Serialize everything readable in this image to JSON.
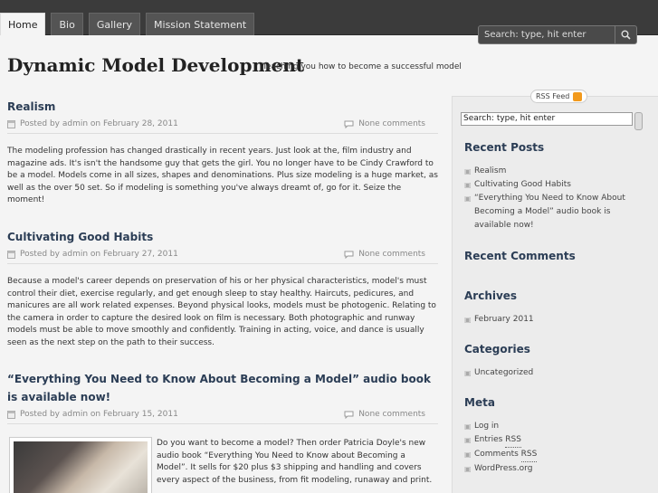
{
  "nav": {
    "tabs": [
      "Home",
      "Bio",
      "Gallery",
      "Mission Statement"
    ],
    "active": 0
  },
  "top_search": {
    "placeholder": "Search: type, hit enter"
  },
  "header": {
    "title": "Dynamic Model Development",
    "tagline": "Teaching you how to become a successful model"
  },
  "posts": [
    {
      "title": "Realism",
      "meta": "Posted by admin on February 28, 2011",
      "comments": "None comments",
      "body": "The modeling  profession has changed drastically in recent years.  Just look at the, film industry and magazine ads.  It's isn't  the handsome guy that gets the girl.  You no longer have to be Cindy Crawford to be a model.  Models come in all sizes, shapes and denominations.  Plus size modeling is a huge market, as well as the over 50 set.  So if modeling is something you've always dreamt of,  go for it.   Seize the moment!"
    },
    {
      "title": "Cultivating Good Habits",
      "meta": "Posted by admin on February 27, 2011",
      "comments": "None comments",
      "body": "Because a model's career depends on preservation of his or her physical characteristics, model's must control their diet, exercise regularly, and get enough sleep to stay healthy.  Haircuts, pedicures, and manicures are all work related expenses.  Beyond physical looks, models must be photogenic.  Relating to the camera in order to capture the desired look on film is necessary.   Both photographic and runway models must be able to move smoothly and confidently.  Training in acting, voice, and dance is usually seen as the next step on the path to their success."
    },
    {
      "title": "“Everything You Need to Know About Becoming a Model” audio book is available now!",
      "meta": "Posted by admin on February 15, 2011",
      "comments": "None comments",
      "body": "Do you want to become a model?  Then order Patricia Doyle's new audio book “Everything You Need to Know about Becoming a Model”.  It sells for $20 plus $3 shipping and handling and covers every aspect of the business, from fit modeling, runaway and print."
    }
  ],
  "sidebar": {
    "rss_feed": "RSS Feed",
    "search_value": "Search: type, hit enter",
    "recent_posts_title": "Recent Posts",
    "recent_posts": [
      "Realism",
      "Cultivating Good Habits",
      "“Everything You Need to Know About Becoming a Model” audio book is available now!"
    ],
    "recent_comments_title": "Recent Comments",
    "archives_title": "Archives",
    "archives": [
      "February 2011"
    ],
    "categories_title": "Categories",
    "categories": [
      "Uncategorized"
    ],
    "meta_title": "Meta",
    "meta_login": "Log in",
    "meta_entries": "Entries",
    "meta_comments": "Comments",
    "meta_rss": "RSS",
    "meta_wordpress": "WordPress.org"
  },
  "colors": {
    "topbar": "#3b3b3b",
    "title_blue": "#2b3d55",
    "rss_orange": "#f29a1d"
  }
}
